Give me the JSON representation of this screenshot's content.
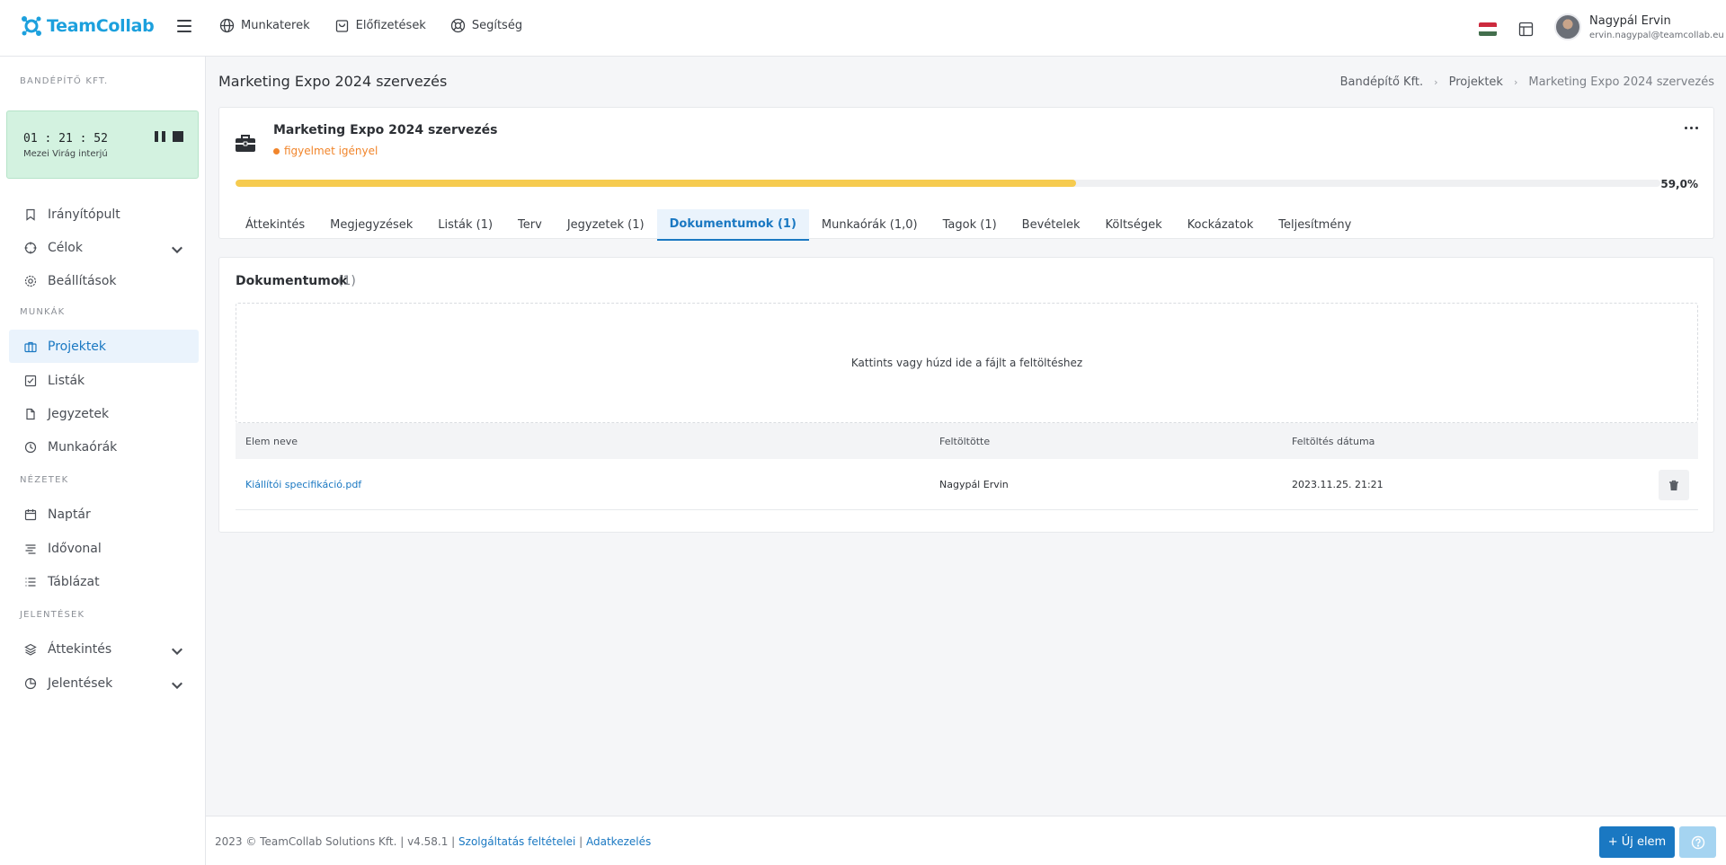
{
  "app": {
    "brand": "TeamCollab",
    "brand_color": "#1ca0dd",
    "accent": "#1a78c2"
  },
  "topnav": [
    {
      "label": "Munkaterek",
      "icon": "globe-icon"
    },
    {
      "label": "Előfizetések",
      "icon": "shopping-bag-icon"
    },
    {
      "label": "Segítség",
      "icon": "lifebuoy-icon"
    }
  ],
  "user": {
    "name": "Nagypál Ervin",
    "email": "ervin.nagypal@teamcollab.eu",
    "language": "hu"
  },
  "sidebar": {
    "org": "BANDÉPÍTŐ KFT.",
    "timer": {
      "time": "01 : 21 : 52",
      "label": "Mezei Virág interjú"
    },
    "items": [
      {
        "label": "Irányítópult",
        "icon": "bookmark-icon"
      },
      {
        "label": "Célok",
        "icon": "target-icon"
      },
      {
        "label": "Beállítások",
        "icon": "gear-icon"
      }
    ],
    "section_munkak": "MUNKÁK",
    "munkak": [
      {
        "label": "Projektek",
        "icon": "briefcase-icon",
        "active": true
      },
      {
        "label": "Listák",
        "icon": "checkbox-icon"
      },
      {
        "label": "Jegyzetek",
        "icon": "file-icon"
      },
      {
        "label": "Munkaórák",
        "icon": "clock-icon"
      }
    ],
    "section_nezetek": "NÉZETEK",
    "nezetek": [
      {
        "label": "Naptár",
        "icon": "calendar-icon"
      },
      {
        "label": "Idővonal",
        "icon": "timeline-icon"
      },
      {
        "label": "Táblázat",
        "icon": "list-icon"
      }
    ],
    "section_jelentesek": "JELENTÉSEK",
    "jelentesek": [
      {
        "label": "Áttekintés",
        "icon": "layers-icon"
      },
      {
        "label": "Jelentések",
        "icon": "pie-chart-icon"
      }
    ]
  },
  "page": {
    "title": "Marketing Expo 2024 szervezés",
    "breadcrumb": [
      "Bandépítő Kft.",
      "Projektek",
      "Marketing Expo 2024 szervezés"
    ]
  },
  "project": {
    "name": "Marketing Expo 2024 szervezés",
    "status": "figyelmet igényel",
    "status_color": "#f1852b",
    "progress": 0.59,
    "progress_label": "59,0%",
    "tabs": [
      "Áttekintés",
      "Megjegyzések",
      "Listák (1)",
      "Terv",
      "Jegyzetek (1)",
      "Dokumentumok (1)",
      "Munkaórák (1,0)",
      "Tagok (1)",
      "Bevételek",
      "Költségek",
      "Kockázatok",
      "Teljesítmény"
    ],
    "active_tab": "Dokumentumok (1)"
  },
  "documents": {
    "title": "Dokumentumok",
    "count": "(1)",
    "dropzone": "Kattints vagy húzd ide a fájlt a feltöltéshez",
    "columns": [
      "Elem neve",
      "Feltöltötte",
      "Feltöltés dátuma"
    ],
    "rows": [
      {
        "name": "Kiállítói specifikáció.pdf",
        "uploader": "Nagypál Ervin",
        "date": "2023.11.25. 21:21"
      }
    ]
  },
  "footer": {
    "copyright": "2023 © TeamCollab Solutions Kft. | v4.58.1 |",
    "terms": "Szolgáltatás feltételei",
    "sep": "|",
    "privacy": "Adatkezelés",
    "new_button": "Új elem"
  }
}
